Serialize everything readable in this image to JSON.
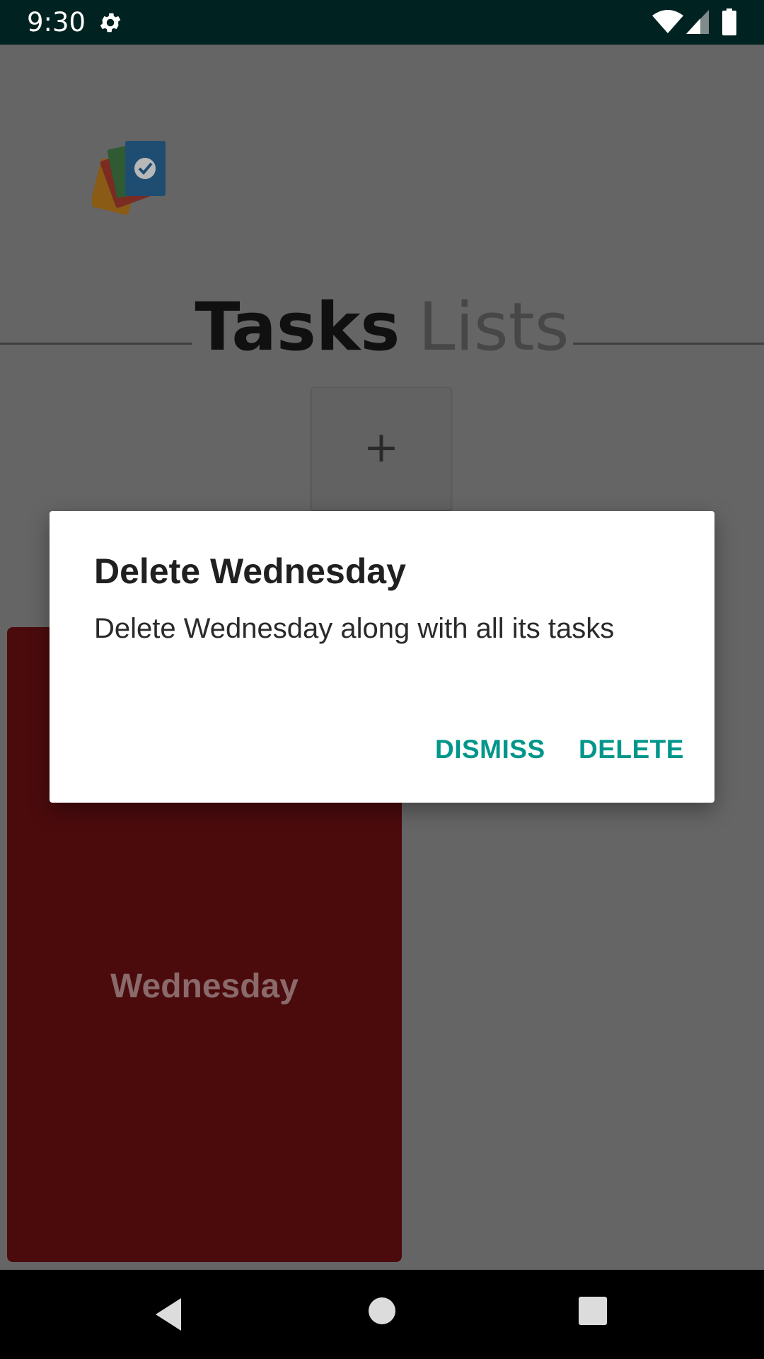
{
  "status_bar": {
    "time": "9:30",
    "icons": [
      "gear-icon",
      "wifi-icon",
      "signal-icon",
      "battery-icon"
    ],
    "background": "#002321"
  },
  "header": {
    "logo": "app-logo-cards",
    "tabs": [
      {
        "label": "Tasks",
        "active": true
      },
      {
        "label": "Lists",
        "active": false
      }
    ]
  },
  "add_button": {
    "icon": "plus-icon",
    "label": "+"
  },
  "list_card": {
    "label": "Wednesday",
    "color": "#4b0b0d"
  },
  "dialog": {
    "title": "Delete Wednesday",
    "message": "Delete Wednesday along with all its tasks",
    "buttons": {
      "dismiss": "DISMISS",
      "delete": "DELETE"
    },
    "accent": "#00968a"
  },
  "nav_bar": {
    "icons": [
      "back-icon",
      "home-icon",
      "recents-icon"
    ]
  }
}
